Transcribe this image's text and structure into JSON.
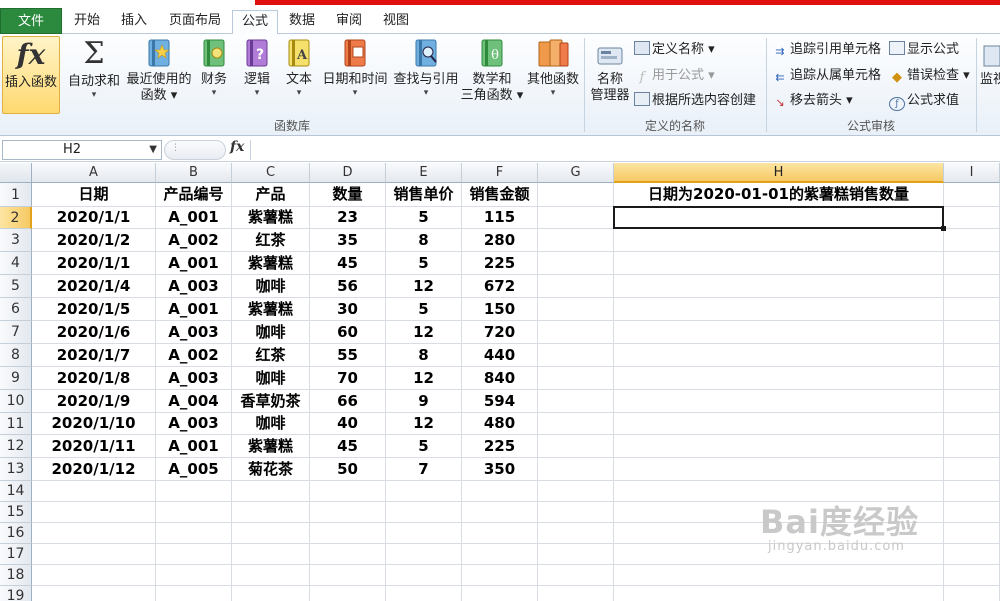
{
  "tabs": [
    {
      "label": "文件"
    },
    {
      "label": "开始"
    },
    {
      "label": "插入"
    },
    {
      "label": "页面布局"
    },
    {
      "label": "公式"
    },
    {
      "label": "数据"
    },
    {
      "label": "审阅"
    },
    {
      "label": "视图"
    }
  ],
  "active_tab": "公式",
  "ribbon": {
    "function_library": {
      "label": "函数库",
      "insert_function": "插入函数",
      "autosum_line1": "自动求和",
      "recent_line1": "最近使用的",
      "recent_line2": "函数",
      "finance": "财务",
      "logic": "逻辑",
      "text": "文本",
      "datetime": "日期和时间",
      "lookup": "查找与引用",
      "math_line1": "数学和",
      "math_line2": "三角函数",
      "other": "其他函数"
    },
    "defined_names": {
      "label": "定义的名称",
      "name_manager_line1": "名称",
      "name_manager_line2": "管理器",
      "define_name": "定义名称",
      "use_in_formula": "用于公式",
      "create_from_selection": "根据所选内容创建"
    },
    "formula_auditing": {
      "label": "公式审核",
      "trace_precedents": "追踪引用单元格",
      "trace_dependents": "追踪从属单元格",
      "remove_arrows": "移去箭头",
      "show_formulas": "显示公式",
      "error_checking": "错误检查",
      "evaluate_formula": "公式求值",
      "watch_partial": "监视"
    }
  },
  "formula_bar": {
    "name_box": "H2",
    "fx": "fx",
    "formula": ""
  },
  "sheet": {
    "columns": [
      "A",
      "B",
      "C",
      "D",
      "E",
      "F",
      "G",
      "H",
      "I"
    ],
    "rows": [
      "1",
      "2",
      "3",
      "4",
      "5",
      "6",
      "7",
      "8",
      "9",
      "10",
      "11",
      "12",
      "13",
      "14",
      "15",
      "16",
      "17",
      "18",
      "19"
    ],
    "selected_cell": "H2",
    "header": [
      "日期",
      "产品编号",
      "产品",
      "数量",
      "销售单价",
      "销售金额"
    ],
    "data": [
      [
        "2020/1/1",
        "A_001",
        "紫薯糕",
        "23",
        "5",
        "115"
      ],
      [
        "2020/1/2",
        "A_002",
        "红茶",
        "35",
        "8",
        "280"
      ],
      [
        "2020/1/1",
        "A_001",
        "紫薯糕",
        "45",
        "5",
        "225"
      ],
      [
        "2020/1/4",
        "A_003",
        "咖啡",
        "56",
        "12",
        "672"
      ],
      [
        "2020/1/5",
        "A_001",
        "紫薯糕",
        "30",
        "5",
        "150"
      ],
      [
        "2020/1/6",
        "A_003",
        "咖啡",
        "60",
        "12",
        "720"
      ],
      [
        "2020/1/7",
        "A_002",
        "红茶",
        "55",
        "8",
        "440"
      ],
      [
        "2020/1/8",
        "A_003",
        "咖啡",
        "70",
        "12",
        "840"
      ],
      [
        "2020/1/9",
        "A_004",
        "香草奶茶",
        "66",
        "9",
        "594"
      ],
      [
        "2020/1/10",
        "A_003",
        "咖啡",
        "40",
        "12",
        "480"
      ],
      [
        "2020/1/11",
        "A_001",
        "紫薯糕",
        "45",
        "5",
        "225"
      ],
      [
        "2020/1/12",
        "A_005",
        "菊花茶",
        "50",
        "7",
        "350"
      ]
    ],
    "h1_title": "日期为2020-01-01的紫薯糕销售数量"
  },
  "watermark": {
    "brand": "Bai度经验",
    "url": "jingyan.baidu.com"
  },
  "colors": {
    "file_tab": "#2b8a3e",
    "selection_header": "#f6c964",
    "top_strip": "#e01010"
  }
}
